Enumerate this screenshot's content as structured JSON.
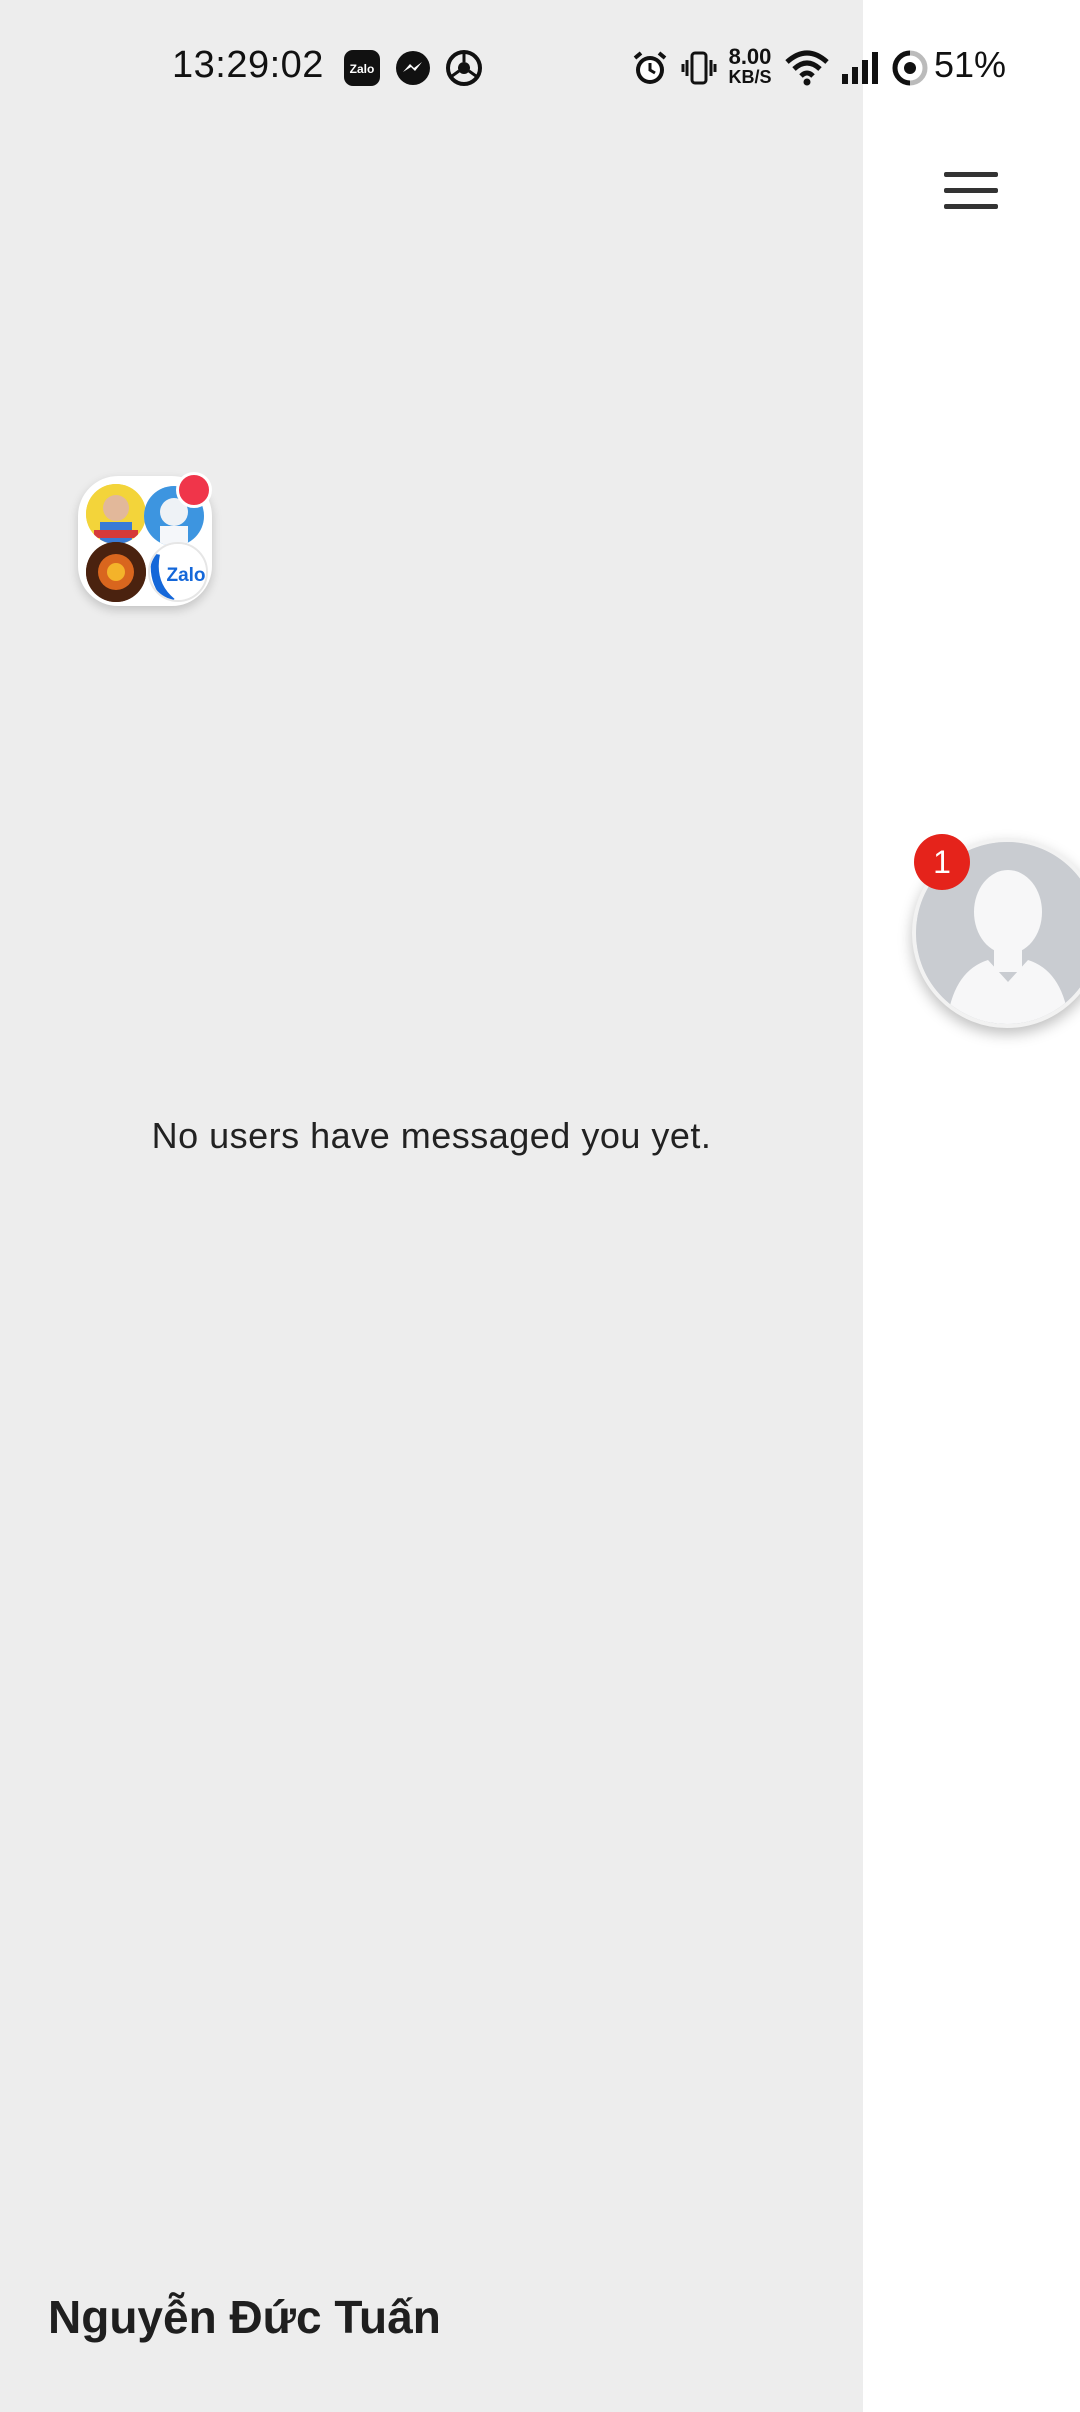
{
  "status_bar": {
    "time": "13:29:02",
    "notification_icons": [
      "zalo-icon",
      "messenger-icon",
      "chrome-icon"
    ],
    "system_icons": [
      "alarm-icon",
      "vibrate-icon",
      "wifi-icon",
      "signal-icon",
      "battery-ring-icon"
    ],
    "net_speed_value": "8.00",
    "net_speed_unit": "KB/S",
    "battery": "51%"
  },
  "drawer": {
    "empty_message": "No users have messaged you yet.",
    "user_name": "Nguyễn Đức Tuấn",
    "app_group_icon_text": "Zalo"
  },
  "chat_head": {
    "badge_count": "1"
  },
  "colors": {
    "drawer_bg": "#ededed",
    "badge_red": "#e5231b",
    "notif_dot": "#f0354a"
  }
}
